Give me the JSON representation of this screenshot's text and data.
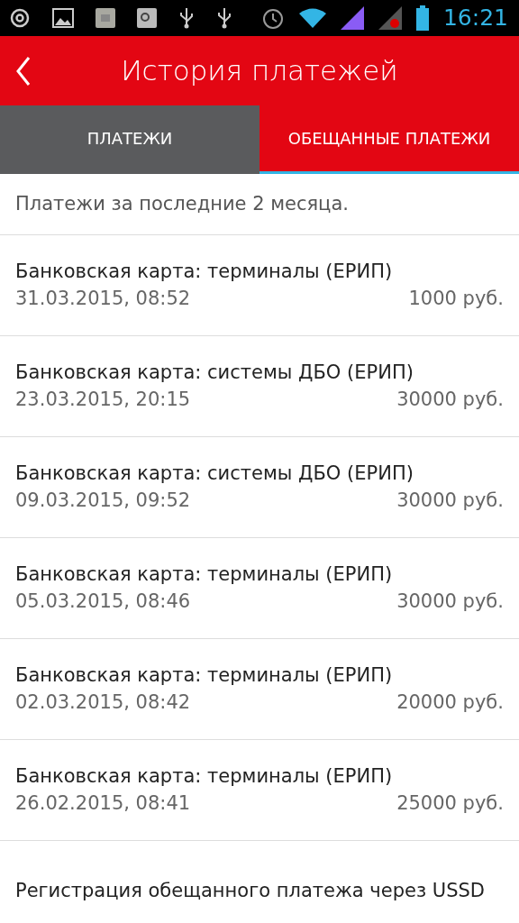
{
  "status_bar": {
    "time": "16:21"
  },
  "header": {
    "title": "История платежей"
  },
  "tabs": [
    {
      "label": "ПЛАТЕЖИ",
      "selected": false
    },
    {
      "label": "ОБЕЩАННЫЕ ПЛАТЕЖИ",
      "selected": true
    }
  ],
  "notice": "Платежи за последние 2 месяца.",
  "payments": [
    {
      "title": "Банковская карта: терминалы (ЕРИП)",
      "date": "31.03.2015, 08:52",
      "amount": "1000 руб."
    },
    {
      "title": "Банковская карта: системы ДБО (ЕРИП)",
      "date": "23.03.2015, 20:15",
      "amount": "30000 руб."
    },
    {
      "title": "Банковская карта: системы ДБО (ЕРИП)",
      "date": "09.03.2015, 09:52",
      "amount": "30000 руб."
    },
    {
      "title": "Банковская карта: терминалы (ЕРИП)",
      "date": "05.03.2015, 08:46",
      "amount": "30000 руб."
    },
    {
      "title": "Банковская карта: терминалы (ЕРИП)",
      "date": "02.03.2015, 08:42",
      "amount": "20000 руб."
    },
    {
      "title": "Банковская карта: терминалы (ЕРИП)",
      "date": "26.02.2015, 08:41",
      "amount": "25000 руб."
    },
    {
      "title": "Регистрация обещанного платежа через USSD"
    }
  ]
}
